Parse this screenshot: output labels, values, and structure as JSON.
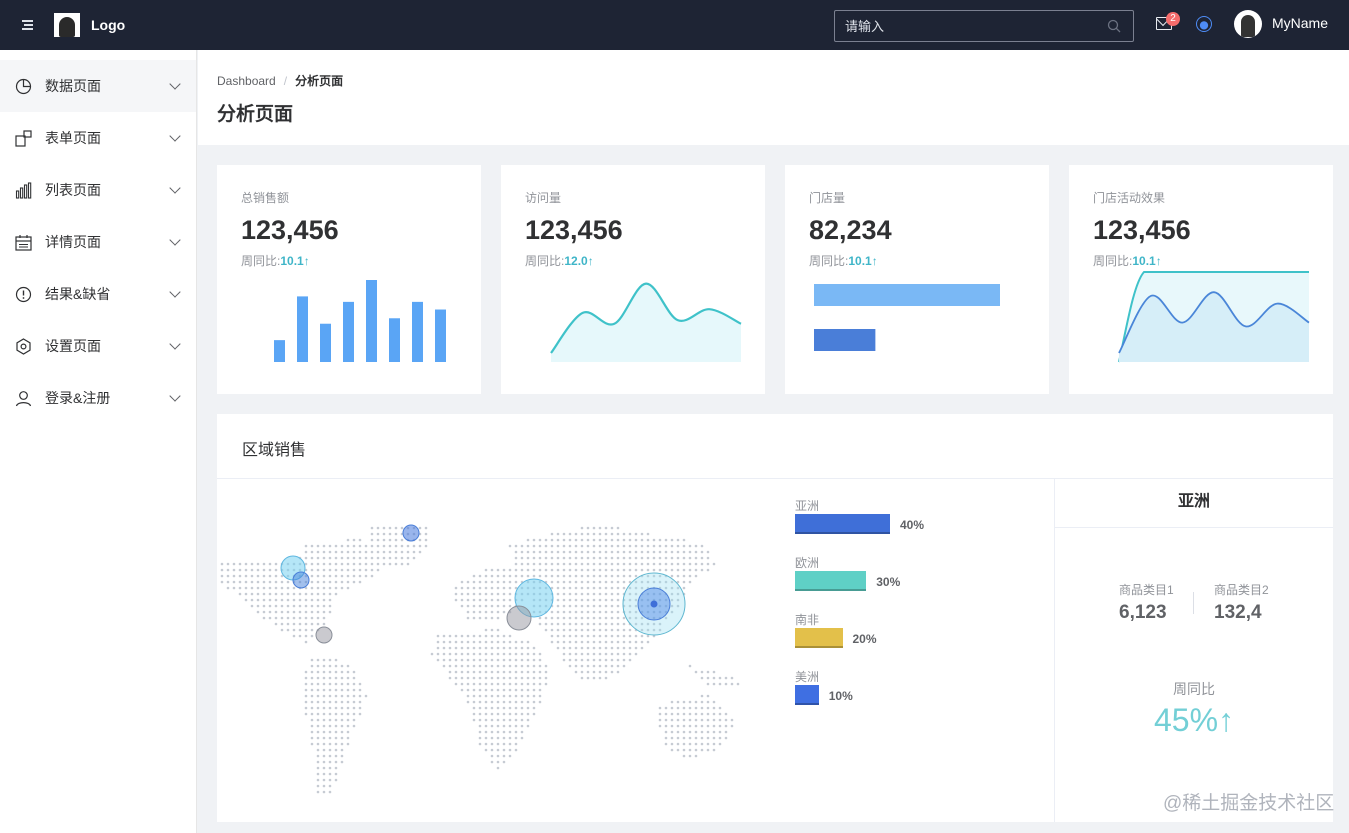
{
  "header": {
    "logo_text": "Logo",
    "search_placeholder": "请输入",
    "mail_badge": "2",
    "user_name": "MyName"
  },
  "sidebar": {
    "items": [
      {
        "label": "数据页面",
        "icon": "pie-chart-icon"
      },
      {
        "label": "表单页面",
        "icon": "form-icon"
      },
      {
        "label": "列表页面",
        "icon": "bar-list-icon"
      },
      {
        "label": "详情页面",
        "icon": "calendar-detail-icon"
      },
      {
        "label": "结果&缺省",
        "icon": "warning-circle-icon"
      },
      {
        "label": "设置页面",
        "icon": "settings-hex-icon"
      },
      {
        "label": "登录&注册",
        "icon": "user-icon"
      }
    ]
  },
  "page": {
    "breadcrumb": [
      "Dashboard",
      "分析页面"
    ],
    "title": "分析页面"
  },
  "cards": [
    {
      "label": "总销售额",
      "value": "123,456",
      "sub_label": "周同比:",
      "sub_value": "10.1↑"
    },
    {
      "label": "访问量",
      "value": "123,456",
      "sub_label": "周同比:",
      "sub_value": "12.0↑"
    },
    {
      "label": "门店量",
      "value": "82,234",
      "sub_label": "周同比:",
      "sub_value": "10.1↑"
    },
    {
      "label": "门店活动效果",
      "value": "123,456",
      "sub_label": "周同比:",
      "sub_value": "10.1↑"
    }
  ],
  "region": {
    "title": "区域销售",
    "legend": [
      {
        "name": "亚洲",
        "pct": "40%",
        "value": 40,
        "color": "#3f6fd8"
      },
      {
        "name": "欧洲",
        "pct": "30%",
        "value": 30,
        "color": "#5fd0c6"
      },
      {
        "name": "南非",
        "pct": "20%",
        "value": 20,
        "color": "#e3c04a"
      },
      {
        "name": "美洲",
        "pct": "10%",
        "value": 10,
        "color": "#3f6fe2"
      }
    ],
    "detail": {
      "title": "亚洲",
      "cat1_label": "商品类目1",
      "cat1_value": "6,123",
      "cat2_label": "商品类目2",
      "cat2_value": "132,4",
      "yoy_label": "周同比",
      "yoy_value": "45%↑"
    }
  },
  "watermark": "@稀土掘金技术社区",
  "colors": {
    "header_bg": "#1e2434",
    "accent": "#3fb5c8",
    "bar_blue": "#5aa5f5",
    "teal_line": "#3fc2c9"
  },
  "chart_data": [
    {
      "type": "bar",
      "values": [
        2,
        6,
        3.5,
        5.5,
        7.5,
        4,
        5.5,
        4.8
      ],
      "categories": []
    },
    {
      "type": "area",
      "values": [
        0,
        1.1,
        0.8,
        1.9,
        0.9,
        1.2,
        0.8
      ],
      "categories": []
    },
    {
      "type": "bar",
      "orientation": "horizontal",
      "values": [
        100,
        33
      ],
      "categories": []
    },
    {
      "type": "area",
      "values": [
        0,
        1.5,
        0.8,
        1.6,
        0.7,
        1.3,
        0.8
      ],
      "categories": []
    }
  ]
}
